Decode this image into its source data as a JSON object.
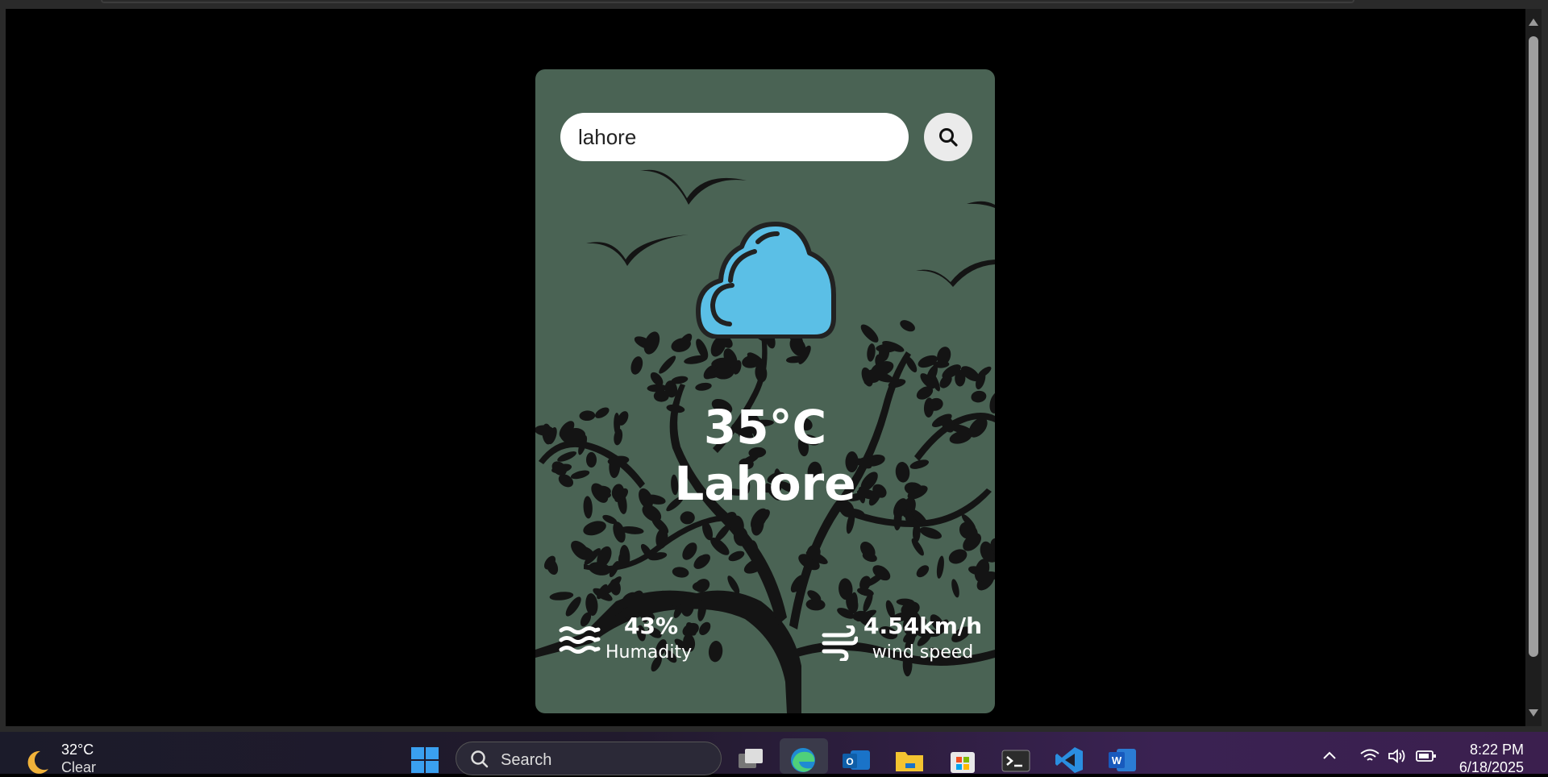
{
  "search": {
    "value": "lahore",
    "button_icon": "search-icon"
  },
  "weather": {
    "icon": "cloud-icon",
    "temperature": "35°C",
    "city": "Lahore",
    "humidity_value": "43%",
    "humidity_label": "Humadity",
    "wind_value": "4.54km/h",
    "wind_label": "wind speed"
  },
  "taskbar": {
    "weather_temp": "32°C",
    "weather_condition": "Clear",
    "search_label": "Search",
    "time": "8:22 PM",
    "date": "6/18/2025",
    "apps": [
      "task-view-icon",
      "edge-icon",
      "outlook-icon",
      "file-explorer-icon",
      "store-icon",
      "terminal-icon",
      "vscode-icon",
      "word-icon"
    ]
  },
  "colors": {
    "card_bg": "#4a6354",
    "cloud_fill": "#5bbfe6",
    "tree_fill": "#141414"
  }
}
